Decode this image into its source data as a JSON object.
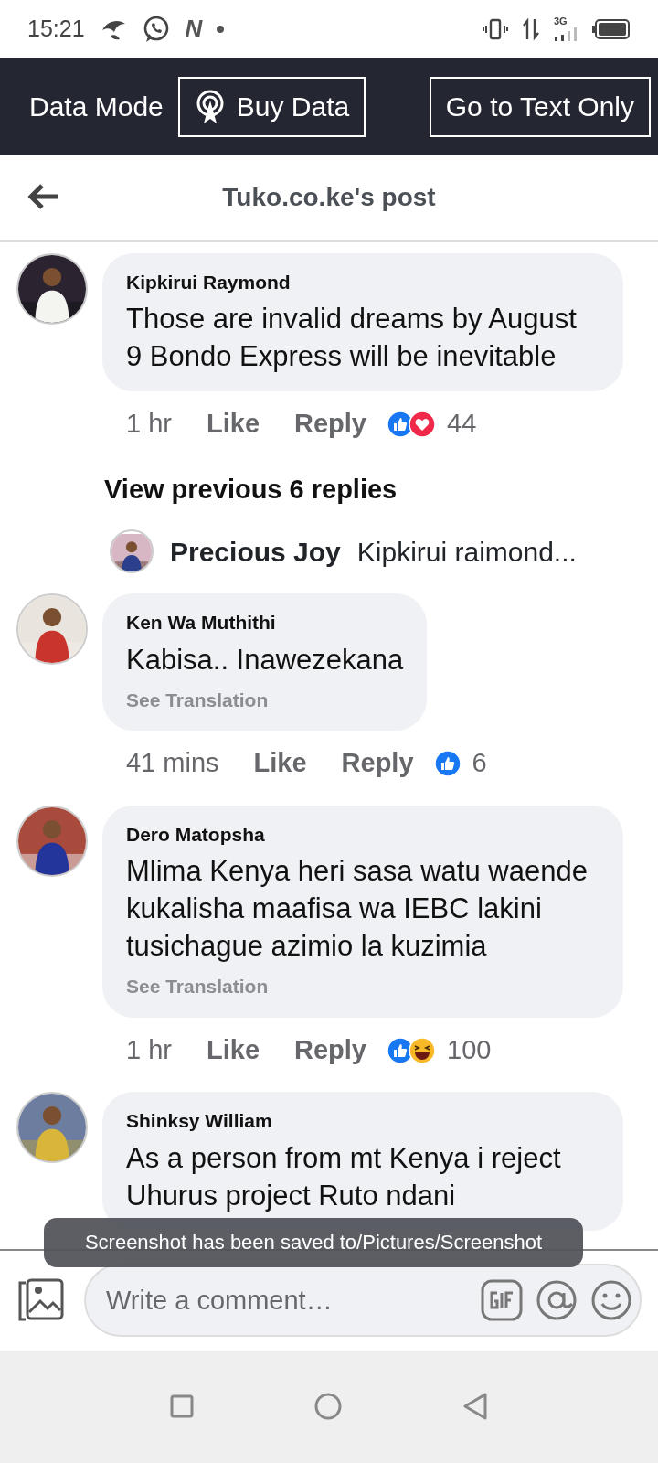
{
  "status_bar": {
    "time": "15:21",
    "app_letter": "N",
    "network": "3G"
  },
  "data_bar": {
    "label": "Data Mode",
    "buttons": [
      {
        "kind": "buy",
        "label": "Buy Data"
      },
      {
        "kind": "text",
        "label": "Go to Text Only"
      }
    ]
  },
  "header": {
    "title": "Tuko.co.ke's post"
  },
  "feed": [
    {
      "kind": "comment",
      "author": "Kipkirui Raymond",
      "text": "Those are invalid dreams by August 9 Bondo Express will be inevitable",
      "time": "1 hr",
      "like": "Like",
      "reply": "Reply",
      "reactions": [
        {
          "kind": "like"
        },
        {
          "kind": "love"
        }
      ],
      "count": "44"
    },
    {
      "kind": "more",
      "label": "View previous 6 replies"
    },
    {
      "kind": "preview",
      "author": "Precious Joy",
      "text": "Kipkirui raimond..."
    },
    {
      "kind": "comment",
      "author": "Ken Wa Muthithi",
      "text": "Kabisa.. Inawezekana",
      "translation": "See Translation",
      "time": "41 mins",
      "like": "Like",
      "reply": "Reply",
      "reactions": [
        {
          "kind": "like"
        }
      ],
      "count": "6"
    },
    {
      "kind": "comment",
      "author": "Dero Matopsha",
      "text": "Mlima Kenya heri sasa watu waende kukalisha maafisa wa IEBC lakini tusichague azimio la kuzimia",
      "translation": "See Translation",
      "time": "1 hr",
      "like": "Like",
      "reply": "Reply",
      "reactions": [
        {
          "kind": "like"
        },
        {
          "kind": "haha"
        }
      ],
      "count": "100"
    },
    {
      "kind": "comment",
      "author": "Shinksy William",
      "text": "As a person from mt Kenya i reject Uhurus project Ruto ndani"
    }
  ],
  "toast": {
    "text": "Screenshot has been saved to/Pictures/Screenshot"
  },
  "composer": {
    "placeholder": "Write a comment…"
  }
}
